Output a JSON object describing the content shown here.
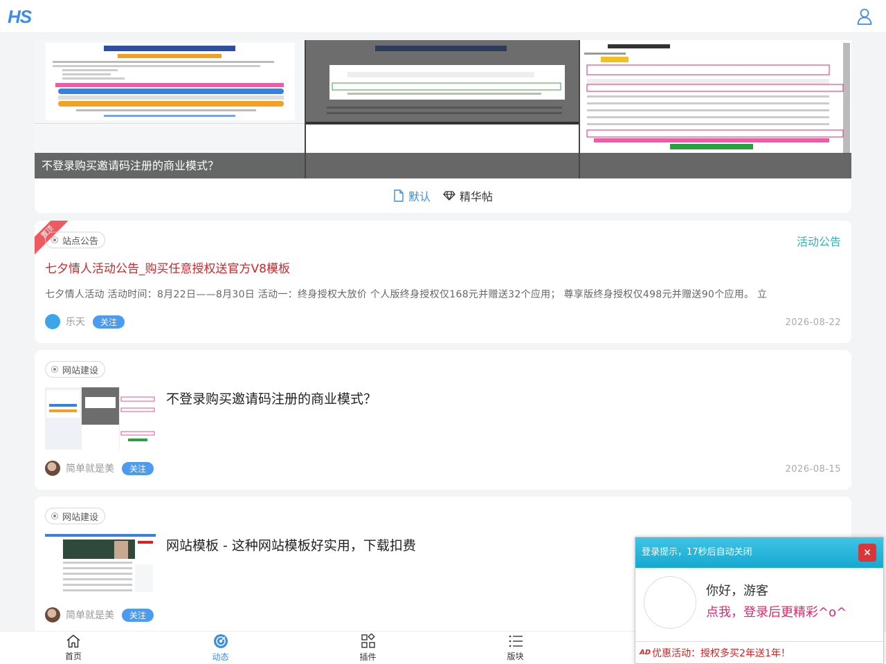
{
  "header": {
    "logo": "HS",
    "user_icon": "user-icon"
  },
  "banner": {
    "caption": "不登录购买邀请码注册的商业模式？",
    "sort_tabs": [
      {
        "label": "默认",
        "icon": "file-icon",
        "active": true
      },
      {
        "label": "精华帖",
        "icon": "diamond-icon",
        "active": false
      }
    ]
  },
  "posts": [
    {
      "ribbon": "置顶",
      "tag": "站点公告",
      "category": "活动公告",
      "title": "七夕情人活动公告_购买任意授权送官方V8模板",
      "excerpt": "七夕情人活动 活动时间：8月22日——8月30日 活动一：终身授权大放价 个人版终身授权仅168元并赠送32个应用； 尊享版终身授权仅498元并赠送90个应用。 立",
      "author": "乐天",
      "follow": "关注",
      "date": "2026-08-22"
    },
    {
      "tag": "网站建设",
      "title": "不登录购买邀请码注册的商业模式？",
      "author": "简单就是美",
      "follow": "关注",
      "date": "2026-08-15"
    },
    {
      "tag": "网站建设",
      "title": "网站模板 - 这种网站模板好实用，下载扣费",
      "author": "简单就是美",
      "follow": "关注"
    }
  ],
  "bottom_nav": [
    {
      "label": "首页",
      "icon": "home-icon",
      "active": false
    },
    {
      "label": "动态",
      "icon": "target-icon",
      "active": true
    },
    {
      "label": "插件",
      "icon": "apps-icon",
      "active": false
    },
    {
      "label": "版块",
      "icon": "list-icon",
      "active": false
    }
  ],
  "popup": {
    "title": "登录提示，17秒后自动关闭",
    "close": "×",
    "greeting": "你好，游客",
    "login_text": "点我，登录后更精彩^o^",
    "ad_mark": "AD",
    "footer": "优惠活动：授权多买2年送1年！"
  },
  "colors": {
    "accent": "#3d8ce6",
    "teal": "#2ab5c0",
    "red_title": "#d0262b",
    "pink": "#e0286b"
  }
}
